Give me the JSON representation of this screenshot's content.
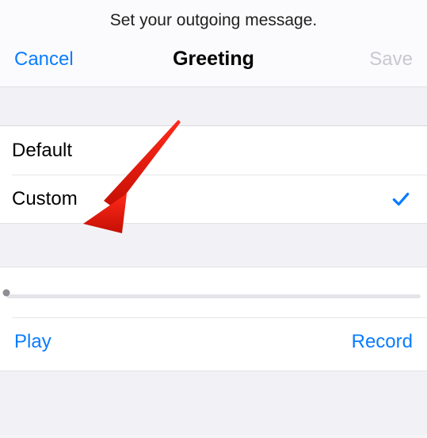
{
  "caption": "Set your outgoing message.",
  "nav": {
    "cancel": "Cancel",
    "title": "Greeting",
    "save": "Save"
  },
  "options": {
    "default_label": "Default",
    "custom_label": "Custom",
    "selected": "custom"
  },
  "controls": {
    "play": "Play",
    "record": "Record"
  }
}
